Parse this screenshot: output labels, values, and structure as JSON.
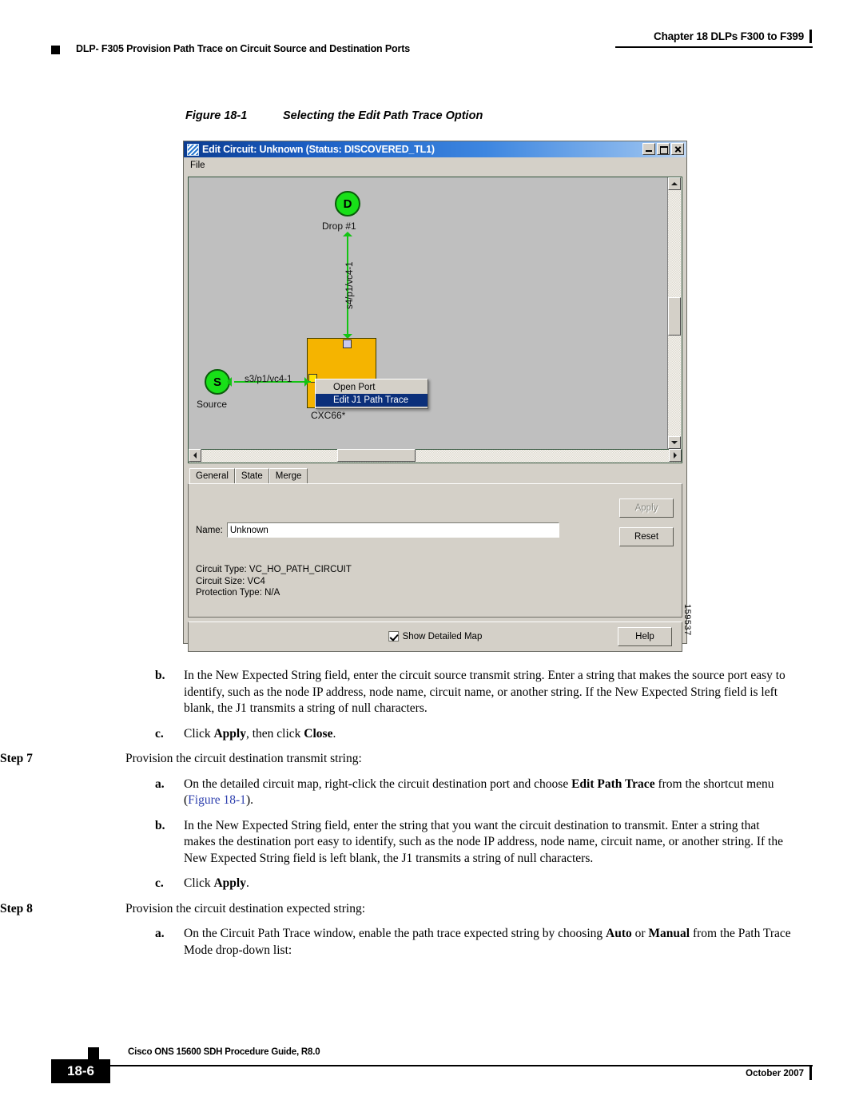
{
  "header": {
    "chapter": "Chapter 18 DLPs F300 to F399",
    "dlp_title": "DLP- F305 Provision Path Trace on Circuit Source and Destination Ports"
  },
  "figure": {
    "number": "Figure 18-1",
    "title": "Selecting the Edit Path Trace Option",
    "id_stamp": "159537"
  },
  "window": {
    "title": "Edit Circuit: Unknown (Status: DISCOVERED_TL1)",
    "menu": {
      "file": "File"
    },
    "controls": {
      "minimize": "Minimize",
      "maximize": "Maximize",
      "close": "Close"
    },
    "map": {
      "drop_node_letter": "D",
      "drop_node_label": "Drop #1",
      "drop_link_label": "s4/p1/vc4-1",
      "source_node_letter": "S",
      "source_node_label": "Source",
      "source_link_label": "s3/p1/vc4-1",
      "card_label": "CXC66*"
    },
    "context_menu": {
      "items": [
        {
          "label": "Open Port",
          "selected": false
        },
        {
          "label": "Edit J1 Path Trace",
          "selected": true
        }
      ]
    },
    "tabs": [
      {
        "label": "General",
        "active": true
      },
      {
        "label": "State",
        "active": false
      },
      {
        "label": "Merge",
        "active": false
      }
    ],
    "form": {
      "name_label": "Name:",
      "name_value": "Unknown",
      "circuit_type": "Circuit Type:  VC_HO_PATH_CIRCUIT",
      "circuit_size": "Circuit Size: VC4",
      "protection_type": "Protection Type:  N/A",
      "apply_label": "Apply",
      "reset_label": "Reset"
    },
    "bottom": {
      "checkbox_label": "Show Detailed Map",
      "checkbox_checked": true,
      "help_label": "Help"
    }
  },
  "body": {
    "paragraphs": [
      {
        "level": "sub",
        "marker": "b.",
        "runs": [
          {
            "t": "In the New Expected String field, enter the circuit source transmit string. Enter a string that makes the source port easy to identify, such as the node IP address, node name, circuit name, or another string. If the New Expected String field is left blank, the J1 transmits a string of null characters.",
            "s": "n"
          }
        ]
      },
      {
        "level": "sub",
        "marker": "c.",
        "runs": [
          {
            "t": "Click ",
            "s": "n"
          },
          {
            "t": "Apply",
            "s": "b"
          },
          {
            "t": ", then click ",
            "s": "n"
          },
          {
            "t": "Close",
            "s": "b"
          },
          {
            "t": ".",
            "s": "n"
          }
        ]
      },
      {
        "level": "step",
        "marker": "Step 7",
        "runs": [
          {
            "t": "Provision the circuit destination transmit string:",
            "s": "n"
          }
        ]
      },
      {
        "level": "sub",
        "marker": "a.",
        "runs": [
          {
            "t": "On the detailed circuit map, right-click the circuit destination port and choose ",
            "s": "n"
          },
          {
            "t": "Edit Path Trace",
            "s": "b"
          },
          {
            "t": " from the shortcut menu (",
            "s": "n"
          },
          {
            "t": "Figure 18-1",
            "s": "x"
          },
          {
            "t": ").",
            "s": "n"
          }
        ]
      },
      {
        "level": "sub",
        "marker": "b.",
        "runs": [
          {
            "t": "In the New Expected String field, enter the string that you want the circuit destination to transmit. Enter a string that makes the destination port easy to identify, such as the node IP address, node name, circuit name, or another string. If the New Expected String field is left blank, the J1 transmits a string of null characters.",
            "s": "n"
          }
        ]
      },
      {
        "level": "sub",
        "marker": "c.",
        "runs": [
          {
            "t": "Click ",
            "s": "n"
          },
          {
            "t": "Apply",
            "s": "b"
          },
          {
            "t": ".",
            "s": "n"
          }
        ]
      },
      {
        "level": "step",
        "marker": "Step 8",
        "runs": [
          {
            "t": "Provision the circuit destination expected string:",
            "s": "n"
          }
        ]
      },
      {
        "level": "sub",
        "marker": "a.",
        "runs": [
          {
            "t": "On the Circuit Path Trace window, enable the path trace expected string by choosing ",
            "s": "n"
          },
          {
            "t": "Auto",
            "s": "b"
          },
          {
            "t": " or ",
            "s": "n"
          },
          {
            "t": "Manual",
            "s": "b"
          },
          {
            "t": " from the Path Trace Mode drop-down list:",
            "s": "n"
          }
        ]
      }
    ]
  },
  "footer": {
    "guide": "Cisco ONS 15600 SDH Procedure Guide, R8.0",
    "page": "18-6",
    "date": "October 2007"
  },
  "colors": {
    "titlebar_blue": "#0b3c91",
    "node_green": "#18e018",
    "card_orange": "#f5b400",
    "menu_select_blue": "#0b2f7a",
    "window_gray": "#d4d0c8",
    "map_gray": "#bfbfbf",
    "xref_blue": "#2d3fae"
  }
}
